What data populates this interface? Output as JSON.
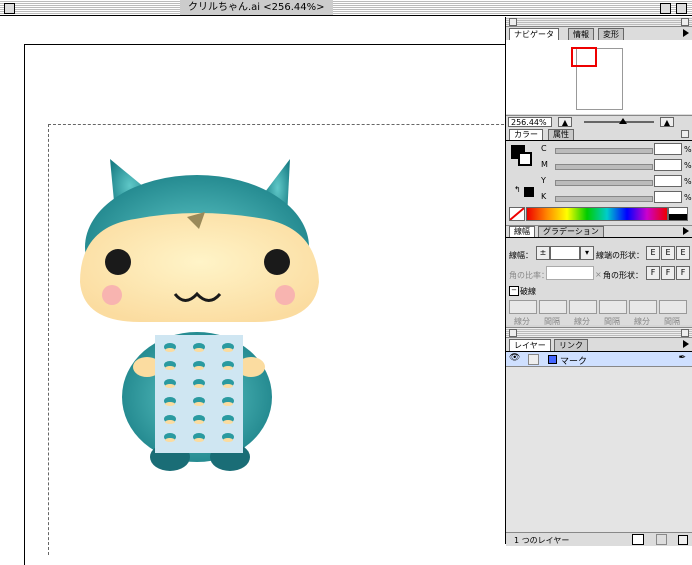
{
  "window": {
    "title": "クリルちゃん.ai <256.44%>"
  },
  "navigator": {
    "tabs": [
      {
        "label": "ナビゲータ"
      },
      {
        "label": "情報"
      },
      {
        "label": "変形"
      }
    ],
    "zoom": "256.44%",
    "view_rect_color": "#e00000"
  },
  "color": {
    "tabs": [
      {
        "label": "カラー"
      },
      {
        "label": "属性"
      }
    ],
    "channels": [
      {
        "label": "C",
        "value": "",
        "unit": "%"
      },
      {
        "label": "M",
        "value": "",
        "unit": "%"
      },
      {
        "label": "Y",
        "value": "",
        "unit": "%"
      },
      {
        "label": "K",
        "value": "",
        "unit": "%"
      }
    ]
  },
  "stroke": {
    "tabs": [
      {
        "label": "線幅"
      },
      {
        "label": "グラデーション"
      }
    ],
    "weight_label": "線幅：",
    "cap_label": "線端の形状：",
    "miter_label": "角の比率：",
    "miter_x": "×",
    "join_label": "角の形状：",
    "dash_label": "破線",
    "dash_fields": [
      "線分",
      "間隔",
      "線分",
      "間隔",
      "線分",
      "間隔"
    ]
  },
  "layers": {
    "tabs": [
      {
        "label": "レイヤー"
      },
      {
        "label": "リンク"
      }
    ],
    "items": [
      {
        "name": "マーク",
        "color": "#4466ff"
      }
    ],
    "footer": "1 つのレイヤー"
  },
  "artwork": {
    "body_color": "#1f8f8f",
    "face_color": "#fde7b0",
    "card_color": "#cfe6f2",
    "cheek_color": "#f8b4b0"
  }
}
